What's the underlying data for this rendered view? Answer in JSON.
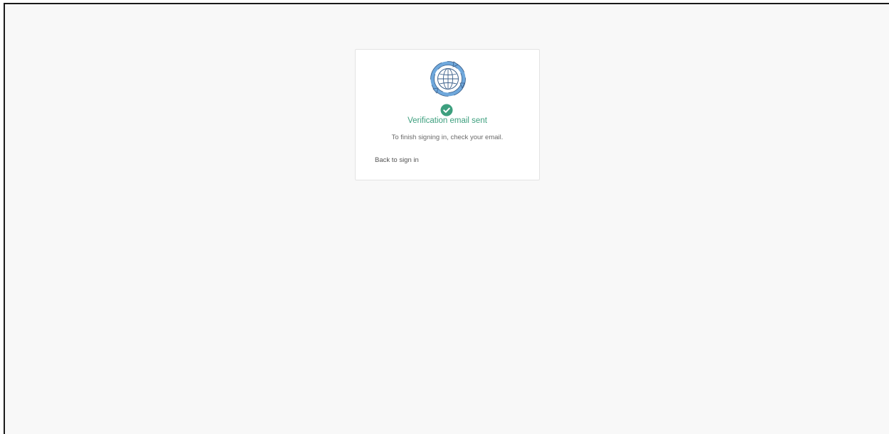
{
  "card": {
    "logo_icon": "globe-with-circular-arrows-icon",
    "status_icon": "check-circle-icon",
    "title": "Verification email sent",
    "message": "To finish signing in, check your email.",
    "back_link": "Back to sign in"
  },
  "colors": {
    "page_background": "#f8f8f8",
    "card_background": "#ffffff",
    "success_green": "#3d9f7e",
    "logo_blue": "#6fa8dc",
    "text_gray": "#6a6a6a"
  }
}
